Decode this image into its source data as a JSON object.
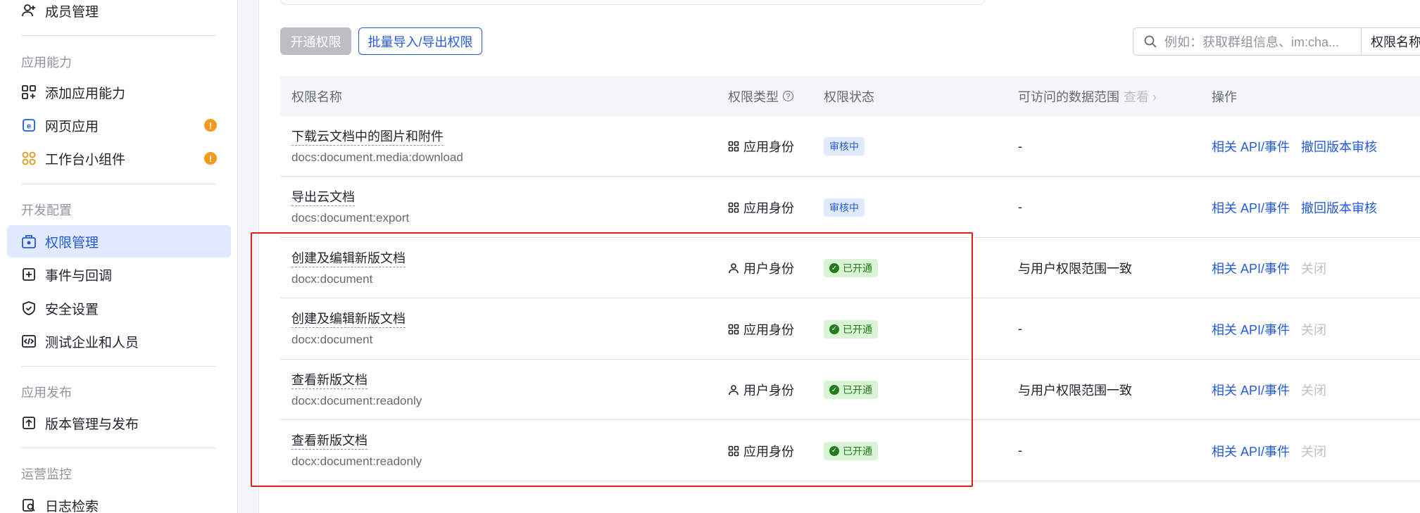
{
  "sidebar": {
    "top_item": "成员管理",
    "groups": [
      {
        "title": "应用能力",
        "items": [
          {
            "label": "添加应用能力",
            "icon": "grid-plus-icon"
          },
          {
            "label": "网页应用",
            "icon": "web-app-icon",
            "badge": "!"
          },
          {
            "label": "工作台小组件",
            "icon": "widget-icon",
            "badge": "!"
          }
        ]
      },
      {
        "title": "开发配置",
        "items": [
          {
            "label": "权限管理",
            "icon": "permission-icon",
            "active": true
          },
          {
            "label": "事件与回调",
            "icon": "event-icon"
          },
          {
            "label": "安全设置",
            "icon": "shield-icon"
          },
          {
            "label": "测试企业和人员",
            "icon": "code-icon"
          }
        ]
      },
      {
        "title": "应用发布",
        "items": [
          {
            "label": "版本管理与发布",
            "icon": "upload-icon"
          }
        ]
      },
      {
        "title": "运营监控",
        "items": [
          {
            "label": "日志检索",
            "icon": "log-search-icon"
          }
        ]
      }
    ]
  },
  "toolbar": {
    "enable_label": "开通权限",
    "batch_label": "批量导入/导出权限",
    "search_placeholder": "例如：获取群组信息、im:cha...",
    "search_type": "权限名称"
  },
  "table": {
    "headers": {
      "name": "权限名称",
      "type": "权限类型",
      "status": "权限状态",
      "scope": "可访问的数据范围",
      "scope_view": "查看",
      "ops": "操作"
    },
    "rows": [
      {
        "title": "下载云文档中的图片和附件",
        "code": "docs:document.media:download",
        "type": "应用身份",
        "type_icon": "app-identity-icon",
        "status": "审核中",
        "status_kind": "review",
        "scope": "-",
        "op1": "相关 API/事件",
        "op2": "撤回版本审核",
        "op2_enabled": true
      },
      {
        "title": "导出云文档",
        "code": "docs:document:export",
        "type": "应用身份",
        "type_icon": "app-identity-icon",
        "status": "审核中",
        "status_kind": "review",
        "scope": "-",
        "op1": "相关 API/事件",
        "op2": "撤回版本审核",
        "op2_enabled": true
      },
      {
        "title": "创建及编辑新版文档",
        "code": "docx:document",
        "type": "用户身份",
        "type_icon": "user-identity-icon",
        "status": "已开通",
        "status_kind": "open",
        "scope": "与用户权限范围一致",
        "op1": "相关 API/事件",
        "op2": "关闭",
        "op2_enabled": false
      },
      {
        "title": "创建及编辑新版文档",
        "code": "docx:document",
        "type": "应用身份",
        "type_icon": "app-identity-icon",
        "status": "已开通",
        "status_kind": "open",
        "scope": "-",
        "op1": "相关 API/事件",
        "op2": "关闭",
        "op2_enabled": false
      },
      {
        "title": "查看新版文档",
        "code": "docx:document:readonly",
        "type": "用户身份",
        "type_icon": "user-identity-icon",
        "status": "已开通",
        "status_kind": "open",
        "scope": "与用户权限范围一致",
        "op1": "相关 API/事件",
        "op2": "关闭",
        "op2_enabled": false
      },
      {
        "title": "查看新版文档",
        "code": "docx:document:readonly",
        "type": "应用身份",
        "type_icon": "app-identity-icon",
        "status": "已开通",
        "status_kind": "open",
        "scope": "-",
        "op1": "相关 API/事件",
        "op2": "关闭",
        "op2_enabled": false
      }
    ]
  },
  "colors": {
    "accent": "#245bdb",
    "highlight_border": "#e02020",
    "open_tag_bg": "#d9f5d6",
    "review_tag_bg": "#e1eaff",
    "badge": "#f39a1f"
  }
}
